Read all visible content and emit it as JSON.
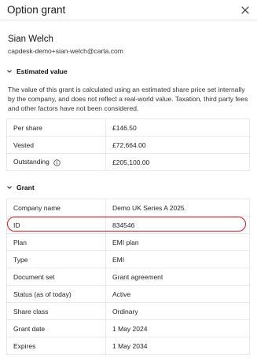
{
  "header": {
    "title": "Option grant"
  },
  "person": {
    "name": "Sian Welch",
    "email": "capdesk-demo+sian-welch@carta.com"
  },
  "estimated": {
    "section_label": "Estimated value",
    "description": "The value of this grant is calculated using an estimated share price set internally by the company, and does not reflect a real-world value. Taxation, third party fees and other factors have not been considered.",
    "rows": [
      {
        "label": "Per share",
        "value": "£146.50"
      },
      {
        "label": "Vested",
        "value": "£72,664.00"
      },
      {
        "label": "Outstanding",
        "value": "£205,100.00"
      }
    ]
  },
  "grant": {
    "section_label": "Grant",
    "rows": [
      {
        "label": "Company name",
        "value": "Demo UK Series A 2025."
      },
      {
        "label": "ID",
        "value": "834546"
      },
      {
        "label": "Plan",
        "value": "EMI plan"
      },
      {
        "label": "Type",
        "value": "EMI"
      },
      {
        "label": "Document set",
        "value": "Grant agreement"
      },
      {
        "label": "Status (as of today)",
        "value": "Active"
      },
      {
        "label": "Share class",
        "value": "Ordinary"
      },
      {
        "label": "Grant date",
        "value": "1 May 2024"
      },
      {
        "label": "Expires",
        "value": "1 May 2034"
      }
    ]
  },
  "icons": {
    "close": "close-icon",
    "chevron": "chevron-down-icon",
    "info": "info-icon"
  },
  "colors": {
    "highlight": "#d8141e",
    "border": "#e6e6e6"
  }
}
